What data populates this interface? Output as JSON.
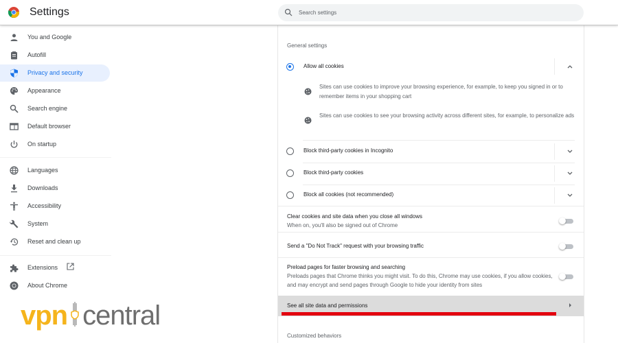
{
  "header": {
    "title": "Settings",
    "search_placeholder": "Search settings"
  },
  "sidebar": {
    "items": [
      {
        "label": "You and Google",
        "icon": "person-icon"
      },
      {
        "label": "Autofill",
        "icon": "clipboard-icon"
      },
      {
        "label": "Privacy and security",
        "icon": "shield-icon",
        "active": true
      },
      {
        "label": "Appearance",
        "icon": "palette-icon"
      },
      {
        "label": "Search engine",
        "icon": "search-icon"
      },
      {
        "label": "Default browser",
        "icon": "browser-window-icon"
      },
      {
        "label": "On startup",
        "icon": "power-icon"
      },
      {
        "label": "Languages",
        "icon": "globe-icon"
      },
      {
        "label": "Downloads",
        "icon": "download-icon"
      },
      {
        "label": "Accessibility",
        "icon": "accessibility-icon"
      },
      {
        "label": "System",
        "icon": "wrench-icon"
      },
      {
        "label": "Reset and clean up",
        "icon": "history-icon"
      },
      {
        "label": "Extensions",
        "icon": "puzzle-icon",
        "external": true
      },
      {
        "label": "About Chrome",
        "icon": "chrome-icon"
      }
    ]
  },
  "content": {
    "general_settings_title": "General settings",
    "cookie_options": [
      {
        "label": "Allow all cookies",
        "selected": true,
        "expanded": true
      },
      {
        "label": "Block third-party cookies in Incognito",
        "selected": false,
        "expanded": false
      },
      {
        "label": "Block third-party cookies",
        "selected": false,
        "expanded": false
      },
      {
        "label": "Block all cookies (not recommended)",
        "selected": false,
        "expanded": false
      }
    ],
    "allow_all_details": [
      "Sites can use cookies to improve your browsing experience, for example, to keep you signed in or to remember items in your shopping cart",
      "Sites can use cookies to see your browsing activity across different sites, for example, to personalize ads"
    ],
    "toggles": [
      {
        "title": "Clear cookies and site data when you close all windows",
        "subtitle": "When on, you'll also be signed out of Chrome",
        "on": false
      },
      {
        "title": "Send a \"Do Not Track\" request with your browsing traffic",
        "subtitle": "",
        "on": false
      },
      {
        "title": "Preload pages for faster browsing and searching",
        "subtitle": "Preloads pages that Chrome thinks you might visit. To do this, Chrome may use cookies, if you allow cookies, and may encrypt and send pages through Google to hide your identity from sites",
        "on": false
      }
    ],
    "site_data_link": "See all site data and permissions",
    "customized_behaviors_title": "Customized behaviors"
  },
  "watermark": {
    "part1": "vpn",
    "part2": "central"
  },
  "colors": {
    "accent": "#1a73e8",
    "active_nav_bg": "#e8f0fe",
    "highlight_underline": "#e3000f",
    "brand_yellow": "#f5b41c",
    "brand_gray": "#6e6e6e"
  }
}
